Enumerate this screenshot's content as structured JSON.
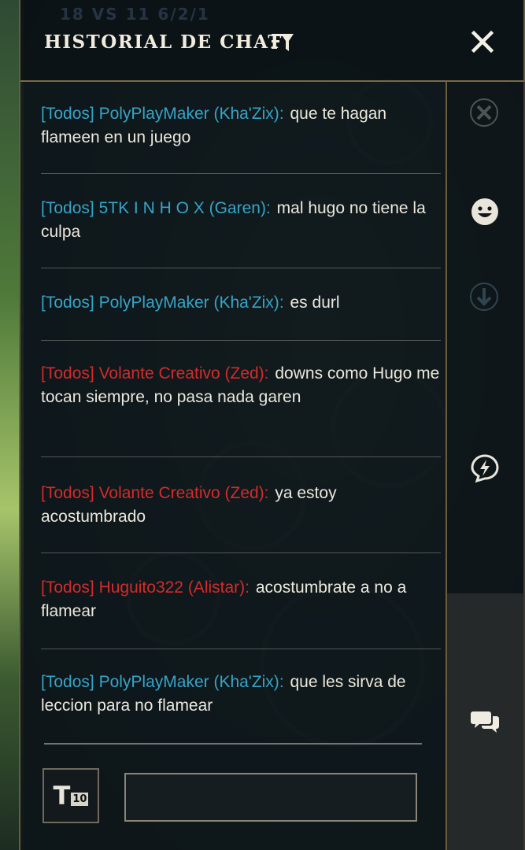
{
  "header": {
    "title": "HISTORIAL DE CHAT",
    "bg_score": "18 VS 11     6/2/1"
  },
  "messages": [
    {
      "team": "blue",
      "tag": "[Todos]",
      "who": "PolyPlayMaker (Kha'Zix)",
      "colon": ":",
      "text": "que te hagan flameen en un juego"
    },
    {
      "team": "blue",
      "tag": "[Todos]",
      "who": "5TK I N  H  O  X (Garen)",
      "colon": ":",
      "text": "mal hugo no tiene la culpa"
    },
    {
      "team": "blue",
      "tag": "[Todos]",
      "who": "PolyPlayMaker (Kha'Zix)",
      "colon": ":",
      "text": "es durl"
    },
    {
      "team": "red",
      "tag": "[Todos]",
      "who": "Volante Creativo (Zed)",
      "colon": ":",
      "text": "downs como Hugo me tocan siempre, no pasa nada garen"
    },
    {
      "team": "red",
      "tag": "[Todos]",
      "who": "Volante Creativo (Zed)",
      "colon": ":",
      "text": "ya estoy acostumbrado"
    },
    {
      "team": "red",
      "tag": "[Todos]",
      "who": "Huguito322 (Alistar)",
      "colon": ":",
      "text": "acostumbrate a no a flamear"
    },
    {
      "team": "blue",
      "tag": "[Todos]",
      "who": "PolyPlayMaker (Kha'Zix)",
      "colon": ":",
      "text": "que les sirva de leccion para no flamear"
    }
  ],
  "input": {
    "team_toggle_letter": "T",
    "team_toggle_number": "10",
    "value": "",
    "placeholder": ""
  },
  "sidebar": {
    "icons": [
      "close-ping-icon",
      "emoji-icon",
      "arrow-down-icon",
      "ping-lightning-icon",
      "chat-bubbles-icon"
    ],
    "active": "chat-bubbles-icon"
  },
  "colors": {
    "blue_team": "#37a4c7",
    "red_team": "#d42b2b",
    "message_text": "#ece8dc",
    "gold_border": "#7a6a45"
  }
}
